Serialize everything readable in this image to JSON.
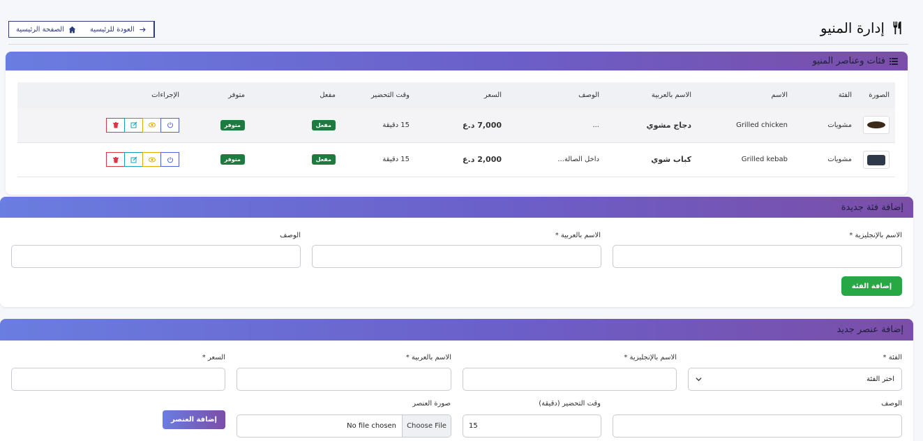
{
  "header": {
    "title": "إدارة المنيو",
    "back_label": "العودة للرئيسية",
    "home_label": "الصفحة الرئيسية"
  },
  "items_card": {
    "title": "فئات وعناصر المنيو",
    "columns": [
      "الصورة",
      "الفئة",
      "الاسم",
      "الاسم بالعربية",
      "الوصف",
      "السعر",
      "وقت التحضير",
      "مفعل",
      "متوفر",
      "الإجراءات"
    ],
    "rows": [
      {
        "category": "مشويات",
        "name": "Grilled chicken",
        "name_ar": "دجاج مشوي",
        "description": "...",
        "price": "7,000 د.ع",
        "prep": "15 دقيقة",
        "active": "مفعل",
        "available": "متوفر"
      },
      {
        "category": "مشويات",
        "name": "Grilled kebab",
        "name_ar": "كباب شوي",
        "description": "داخل الصالة...",
        "price": "2,000 د.ع",
        "prep": "15 دقيقة",
        "active": "مفعل",
        "available": "متوفر"
      }
    ]
  },
  "category_form": {
    "title": "إضافة فئة جديدة",
    "name_en_label": "الاسم بالإنجليزية *",
    "name_ar_label": "الاسم بالعربية *",
    "desc_label": "الوصف",
    "submit_label": "إضافة الفئة"
  },
  "item_form": {
    "title": "إضافة عنصر جديد",
    "category_label": "الفئة *",
    "category_value": "اختر الفئة",
    "name_en_label": "الاسم بالإنجليزية *",
    "name_ar_label": "الاسم بالعربية *",
    "price_label": "السعر *",
    "desc_label": "الوصف",
    "prep_label": "وقت التحضير (دقيقة)",
    "prep_value": "15",
    "image_label": "صورة العنصر",
    "file_button": "Choose File",
    "file_name": "No file chosen",
    "submit_label": "إضافة العنصر"
  }
}
